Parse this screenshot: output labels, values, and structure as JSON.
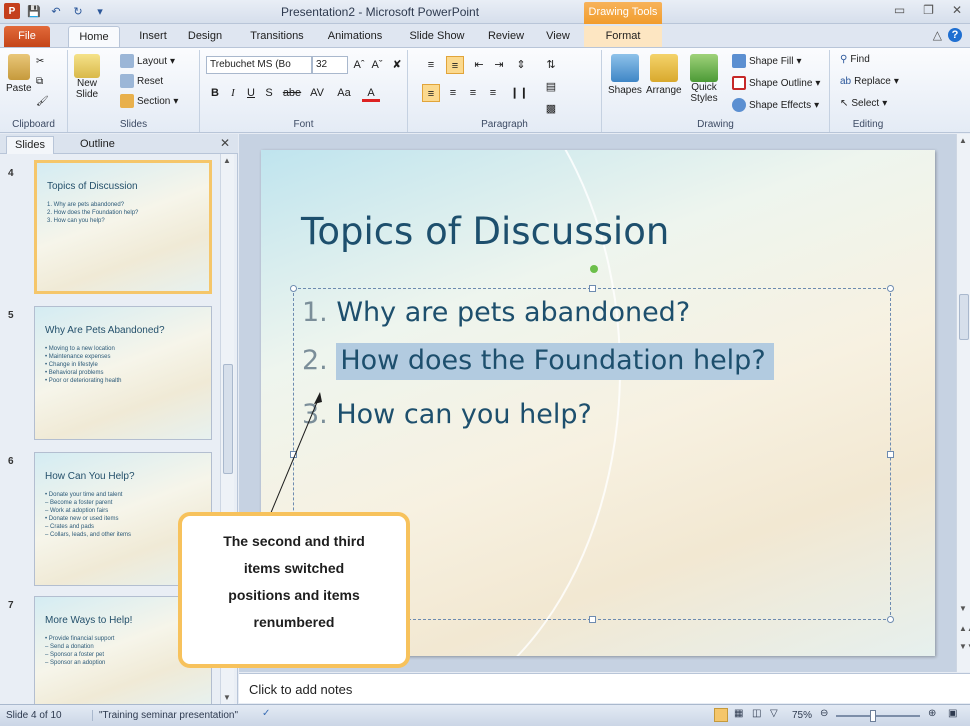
{
  "window": {
    "title": "Presentation2 - Microsoft PowerPoint",
    "contextual_tab_title": "Drawing Tools",
    "app_icon": "P"
  },
  "colors": {
    "file_tab": "#c44519",
    "contextual": "#f19c2c",
    "callout_border": "#f7c25c",
    "selection_highlight": "#b2cbe0",
    "title_text": "#1d4f6d"
  },
  "tabs": [
    "File",
    "Home",
    "Insert",
    "Design",
    "Transitions",
    "Animations",
    "Slide Show",
    "Review",
    "View",
    "Format"
  ],
  "ribbon": {
    "clipboard": {
      "paste": "Paste",
      "label": "Clipboard"
    },
    "slides": {
      "new_slide": "New",
      "new_slide2": "Slide",
      "layout": "Layout",
      "reset": "Reset",
      "section": "Section",
      "label": "Slides"
    },
    "font": {
      "name": "Trebuchet MS (Bo",
      "size": "32",
      "label": "Font",
      "bold": "B",
      "italic": "I",
      "underline": "U",
      "strike": "S",
      "abc": "abe",
      "aa": "Aa"
    },
    "paragraph": {
      "label": "Paragraph"
    },
    "drawing": {
      "shapes": "Shapes",
      "arrange": "Arrange",
      "quick": "Quick",
      "styles": "Styles",
      "fill": "Shape Fill",
      "outline": "Shape Outline",
      "effects": "Shape Effects",
      "label": "Drawing"
    },
    "editing": {
      "find": "Find",
      "replace": "Replace",
      "select": "Select",
      "label": "Editing"
    }
  },
  "pane": {
    "tab_slides": "Slides",
    "tab_outline": "Outline",
    "thumbs": [
      {
        "num": "4",
        "title": "Topics of Discussion",
        "lines": [
          "1. Why are pets abandoned?",
          "2. How does the Foundation  help?",
          "3. How can you help?"
        ]
      },
      {
        "num": "5",
        "title": "Why Are Pets Abandoned?",
        "lines": [
          "• Moving to a new location",
          "• Maintenance  expenses",
          "• Change  in lifestyle",
          "• Behavioral  problems",
          "• Poor  or deteriorating  health"
        ]
      },
      {
        "num": "6",
        "title": "How Can You Help?",
        "lines": [
          "• Donate  your time and talent",
          "  – Become a foster parent",
          "  – Work at adoption fairs",
          "• Donate  new or used items",
          "  – Crates and pads",
          "  – Collars, leads, and other items"
        ]
      },
      {
        "num": "7",
        "title": "More Ways to Help!",
        "lines": [
          "• Provide  financial  support",
          "  – Send a donation",
          "  – Sponsor a foster pet",
          "  – Sponsor an adoption"
        ]
      }
    ]
  },
  "slide": {
    "title": "Topics of Discussion",
    "items": [
      {
        "num": "1.",
        "text": "Why are pets abandoned?"
      },
      {
        "num": "2.",
        "text": "How does the Foundation help?"
      },
      {
        "num": "3.",
        "text": "How can you help?"
      }
    ]
  },
  "notes": {
    "placeholder": "Click to add notes"
  },
  "status": {
    "slide_count": "Slide 4 of 10",
    "theme": "\"Training seminar presentation\"",
    "zoom": "75%"
  },
  "callout": {
    "lines": [
      "The second and third",
      "items switched",
      "positions and items",
      "renumbered"
    ]
  }
}
